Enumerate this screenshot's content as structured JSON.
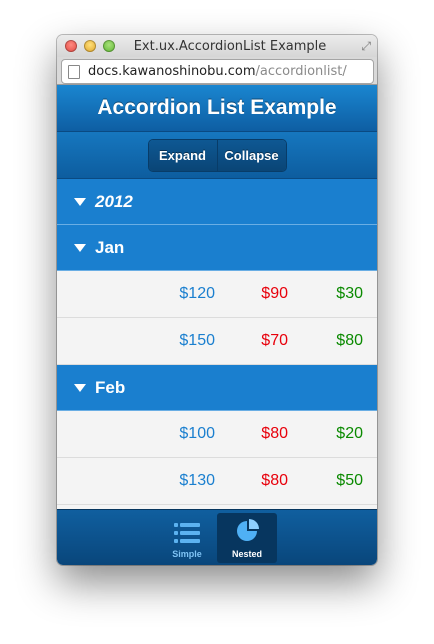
{
  "window": {
    "title": "Ext.ux.AccordionList Example"
  },
  "address_bar": {
    "host": "docs.kawanoshinobu.com",
    "path": "/accordionlist/"
  },
  "app": {
    "title": "Accordion List Example",
    "segmented": {
      "expand_label": "Expand",
      "collapse_label": "Collapse"
    },
    "list": {
      "year": "2012",
      "groups": [
        {
          "label": "Jan",
          "rows": [
            {
              "blue": "$120",
              "red": "$90",
              "green": "$30"
            },
            {
              "blue": "$150",
              "red": "$70",
              "green": "$80"
            }
          ]
        },
        {
          "label": "Feb",
          "rows": [
            {
              "blue": "$100",
              "red": "$80",
              "green": "$20"
            },
            {
              "blue": "$130",
              "red": "$80",
              "green": "$50"
            }
          ]
        }
      ]
    },
    "tabbar": {
      "tabs": [
        {
          "label": "Simple",
          "icon": "list-icon",
          "active": false
        },
        {
          "label": "Nested",
          "icon": "pie-chart-icon",
          "active": true
        }
      ]
    }
  },
  "colors": {
    "header_blue": "#1a7fcf",
    "value_blue": "#1a7fcf",
    "value_red": "#e8000b",
    "value_green": "#0a8a00"
  }
}
